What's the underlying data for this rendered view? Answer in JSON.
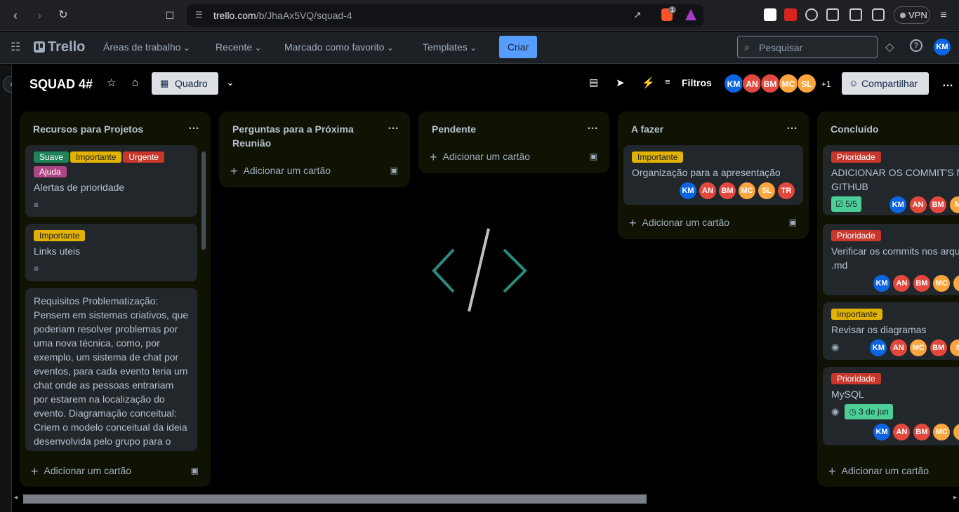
{
  "browser": {
    "url_host": "trello.com",
    "url_path": "/b/JhaAx5VQ/squad-4",
    "vpn_label": "VPN",
    "brave_badge": "1",
    "profile_initials": "KM"
  },
  "header": {
    "logo": "Trello",
    "nav": [
      "Áreas de trabalho",
      "Recente",
      "Marcado como favorito",
      "Templates"
    ],
    "create_label": "Criar",
    "search_placeholder": "Pesquisar",
    "user_initials": "KM"
  },
  "board": {
    "title": "SQUAD 4#",
    "view_label": "Quadro",
    "filters_label": "Filtros",
    "members": [
      {
        "initials": "KM",
        "color": "#0c66e4"
      },
      {
        "initials": "AN",
        "color": "#e2483d"
      },
      {
        "initials": "BM",
        "color": "#e2483d"
      },
      {
        "initials": "MC",
        "color": "#faa53d"
      },
      {
        "initials": "SL",
        "color": "#faa53d"
      }
    ],
    "extra_members": "+1",
    "share_label": "Compartilhar"
  },
  "colors": {
    "label_green": "#4bce97",
    "label_yellow": "#e2b203",
    "label_red": "#f87168",
    "label_purple": "#9f8fef",
    "label_pink": "#e774bb",
    "label_prioridade": "#c9372c"
  },
  "lists": [
    {
      "title": "Recursos para Projetos",
      "add_label": "Adicionar um cartão",
      "cards": [
        {
          "labels": [
            "Suave",
            "Importante",
            "Urgente",
            "Ajuda"
          ],
          "title": "Alertas de prioridade"
        },
        {
          "labels": [
            "Importante"
          ],
          "title": "Links uteis"
        },
        {
          "labels": [],
          "title": "Requisitos Problematização: Pensem em sistemas criativos, que poderiam resolver problemas por uma nova técnica, como, por exemplo, um sistema de chat por eventos, para cada evento teria um chat onde as pessoas entrariam por estarem na localização do evento. Diagramação conceitual: Criem o modelo conceitual da ideia desenvolvida pelo grupo para o sistema. Desenvolvam um diagrama..."
        }
      ]
    },
    {
      "title": "Perguntas para a Próxima Reunião",
      "add_label": "Adicionar um cartão",
      "cards": []
    },
    {
      "title": "Pendente",
      "add_label": "Adicionar um cartão",
      "cards": []
    },
    {
      "title": "A fazer",
      "add_label": "Adicionar um cartão",
      "cards": [
        {
          "labels": [
            "Importante"
          ],
          "title": "Organização para a apresentação",
          "members": [
            "KM",
            "AN",
            "BM",
            "MC",
            "SL",
            "TR"
          ]
        }
      ]
    },
    {
      "title": "Concluído",
      "add_label": "Adicionar um cartão",
      "cards": [
        {
          "labels": [
            "Prioridade"
          ],
          "title": "ADICIONAR OS COMMIT'S NO GITHUB",
          "checklist": "5/5",
          "members": [
            "KM",
            "AN",
            "BM",
            "M"
          ]
        },
        {
          "labels": [
            "Prioridade"
          ],
          "title": "Verificar os commits nos arquivos .md",
          "members": [
            "KM",
            "AN",
            "BM",
            "MC",
            "S"
          ]
        },
        {
          "labels": [
            "Importante"
          ],
          "title": "Revisar os diagramas",
          "members": [
            "KM",
            "AN",
            "MC",
            "BM",
            "S"
          ]
        },
        {
          "labels": [
            "Prioridade"
          ],
          "title": "MySQL",
          "due": "3 de jun",
          "members": [
            "KM",
            "AN",
            "BM",
            "MC",
            "S"
          ]
        }
      ]
    }
  ]
}
